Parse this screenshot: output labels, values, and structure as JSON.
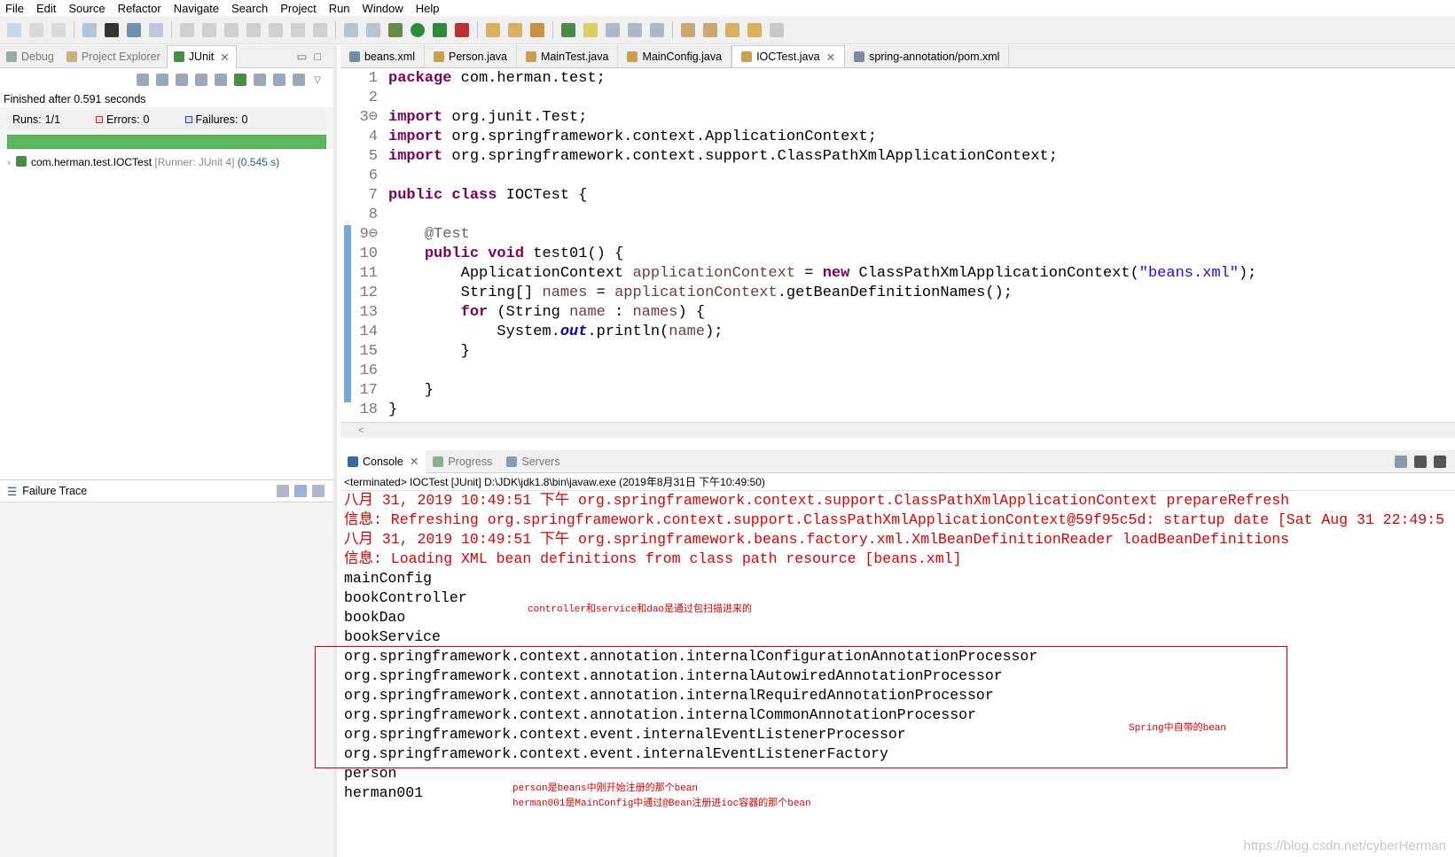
{
  "menu": [
    "File",
    "Edit",
    "Source",
    "Refactor",
    "Navigate",
    "Search",
    "Project",
    "Run",
    "Window",
    "Help"
  ],
  "left_tabs": [
    {
      "label": "Debug"
    },
    {
      "label": "Project Explorer"
    },
    {
      "label": "JUnit"
    }
  ],
  "junit": {
    "finished": "Finished after 0.591 seconds",
    "runs_label": "Runs:",
    "runs": "1/1",
    "errors_label": "Errors:",
    "errors": "0",
    "failures_label": "Failures:",
    "failures": "0",
    "progress": 1.0,
    "tree_item": "com.herman.test.IOCTest",
    "tree_runner": "[Runner: JUnit 4]",
    "tree_time": "(0.545 s)",
    "failure_trace": "Failure Trace"
  },
  "editor_tabs": [
    "beans.xml",
    "Person.java",
    "MainTest.java",
    "MainConfig.java",
    "IOCTest.java",
    "spring-annotation/pom.xml"
  ],
  "code_lines": [
    {
      "n": "1",
      "html": "<span class='kw'>package</span> com.herman.test;"
    },
    {
      "n": "2",
      "html": ""
    },
    {
      "n": "3⊖",
      "html": "<span class='kw'>import</span> org.junit.Test;"
    },
    {
      "n": "4",
      "html": "<span class='kw'>import</span> org.springframework.context.ApplicationContext;"
    },
    {
      "n": "5",
      "html": "<span class='kw'>import</span> org.springframework.context.support.ClassPathXmlApplicationContext;"
    },
    {
      "n": "6",
      "html": ""
    },
    {
      "n": "7",
      "html": "<span class='kw'>public</span> <span class='kw'>class</span> IOCTest {"
    },
    {
      "n": "8",
      "html": ""
    },
    {
      "n": "9⊖",
      "html": "    <span class='an'>@Test</span>"
    },
    {
      "n": "10",
      "html": "    <span class='kw'>public</span> <span class='kw'>void</span> test01() {"
    },
    {
      "n": "11",
      "html": "        ApplicationContext <span class='vr'>applicationContext</span> = <span class='kw'>new</span> ClassPathXmlApplicationContext(<span class='st'>\"beans.xml\"</span>);"
    },
    {
      "n": "12",
      "html": "        String[] <span class='vr'>names</span> = <span class='vr'>applicationContext</span>.getBeanDefinitionNames();"
    },
    {
      "n": "13",
      "html": "        <span class='kw'>for</span> (String <span class='vr'>name</span> : <span class='vr'>names</span>) {"
    },
    {
      "n": "14",
      "html": "            System.<span class='fld'>out</span>.println(<span class='vr'>name</span>);"
    },
    {
      "n": "15",
      "html": "        }"
    },
    {
      "n": "16",
      "html": ""
    },
    {
      "n": "17",
      "html": "    }"
    },
    {
      "n": "18",
      "html": "}"
    }
  ],
  "console_tabs": [
    "Console",
    "Progress",
    "Servers"
  ],
  "terminated": "<terminated> IOCTest [JUnit] D:\\JDK\\jdk1.8\\bin\\javaw.exe (2019年8月31日 下午10:49:50)",
  "console_lines": [
    {
      "red": true,
      "text": "八月 31, 2019 10:49:51 下午 org.springframework.context.support.ClassPathXmlApplicationContext prepareRefresh"
    },
    {
      "red": true,
      "text": "信息: Refreshing org.springframework.context.support.ClassPathXmlApplicationContext@59f95c5d: startup date [Sat Aug 31 22:49:5"
    },
    {
      "red": true,
      "text": "八月 31, 2019 10:49:51 下午 org.springframework.beans.factory.xml.XmlBeanDefinitionReader loadBeanDefinitions"
    },
    {
      "red": true,
      "text": "信息: Loading XML bean definitions from class path resource [beans.xml]"
    },
    {
      "red": false,
      "text": "mainConfig"
    },
    {
      "red": false,
      "text": "bookController"
    },
    {
      "red": false,
      "text": "bookDao"
    },
    {
      "red": false,
      "text": "bookService"
    },
    {
      "red": false,
      "text": "org.springframework.context.annotation.internalConfigurationAnnotationProcessor"
    },
    {
      "red": false,
      "text": "org.springframework.context.annotation.internalAutowiredAnnotationProcessor"
    },
    {
      "red": false,
      "text": "org.springframework.context.annotation.internalRequiredAnnotationProcessor"
    },
    {
      "red": false,
      "text": "org.springframework.context.annotation.internalCommonAnnotationProcessor"
    },
    {
      "red": false,
      "text": "org.springframework.context.event.internalEventListenerProcessor"
    },
    {
      "red": false,
      "text": "org.springframework.context.event.internalEventListenerFactory"
    },
    {
      "red": false,
      "text": "person"
    },
    {
      "red": false,
      "text": "herman001"
    }
  ],
  "notes": {
    "scan": "controller和service和dao是通过包扫描进来的",
    "spring": "Spring中自带的bean",
    "person": "person是beans中刚开始注册的那个bean",
    "herman": "herman001是MainConfig中通过@Bean注册进ioc容器的那个bean"
  },
  "watermark": "https://blog.csdn.net/cyberHerman",
  "colors": {
    "keyword": "#7f0055",
    "string": "#2a00ff",
    "annotation_red": "#e00000",
    "junit_green": "#5cb85c"
  }
}
